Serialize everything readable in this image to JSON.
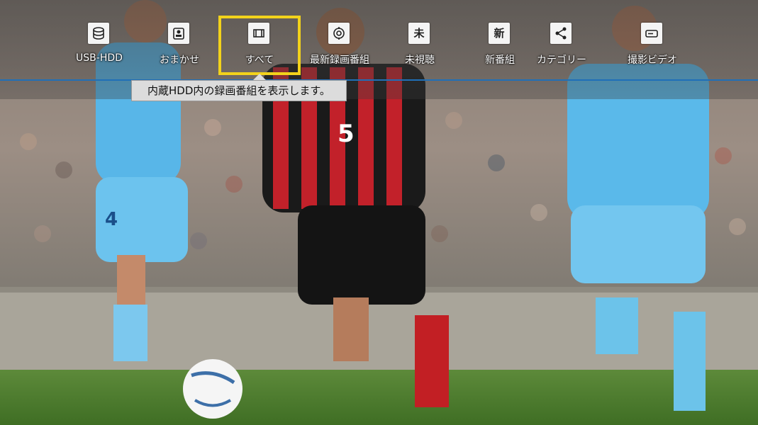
{
  "menu": {
    "items": [
      {
        "label": "USB-HDD",
        "icon": "usb-hdd-icon"
      },
      {
        "label": "おまかせ",
        "icon": "omakase-icon"
      },
      {
        "label": "すべて",
        "icon": "all-recordings-icon",
        "selected": true
      },
      {
        "label": "最新録画番組",
        "icon": "latest-recording-icon"
      },
      {
        "label": "未視聴",
        "icon": "unwatched-icon",
        "glyph": "未"
      },
      {
        "label": "新番組",
        "icon": "new-program-icon",
        "glyph": "新"
      },
      {
        "label": "カテゴリー",
        "icon": "category-icon"
      },
      {
        "label": "撮影ビデオ",
        "icon": "camera-video-icon"
      }
    ],
    "tooltip": "内蔵HDD内の録画番組を表示します。"
  },
  "colors": {
    "selection": "#f2d21b",
    "accent_line": "#1f6fb8",
    "tooltip_bg": "#dcdcdc"
  }
}
